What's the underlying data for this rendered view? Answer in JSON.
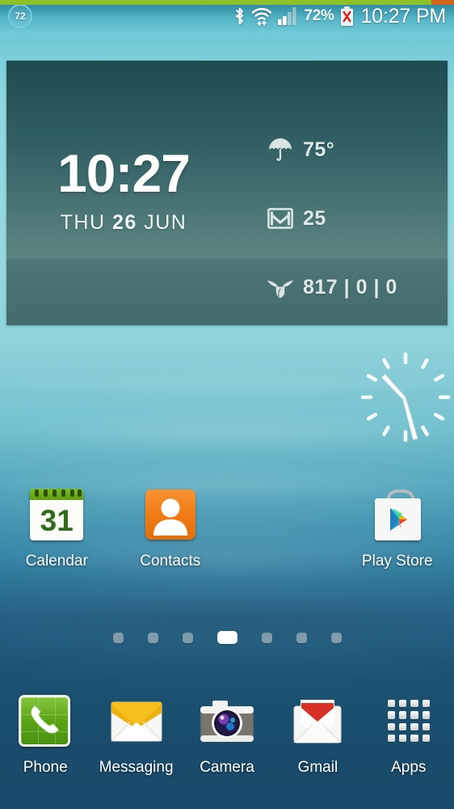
{
  "accent_bar": {
    "fill_percent": 95,
    "fill_color": "#8cc227",
    "track_color": "#d2661d"
  },
  "status_bar": {
    "left_badge": "72",
    "battery_percent": "72%",
    "clock": "10:27 PM",
    "icons": [
      "bluetooth-icon",
      "wifi-icon",
      "signal-icon",
      "battery-error-icon"
    ]
  },
  "widget": {
    "time": "10:27",
    "date_day": "THU",
    "date_num": "26",
    "date_month": "JUN",
    "info": [
      {
        "icon": "umbrella-icon",
        "value": "75°"
      },
      {
        "icon": "gmail-icon",
        "value": "25"
      },
      {
        "icon": "bird-icon",
        "value": "817 | 0 | 0"
      }
    ]
  },
  "analog_clock": {
    "hour": 10,
    "minute": 27,
    "ticks": 12
  },
  "apps": [
    {
      "label": "Calendar",
      "icon": "calendar-icon",
      "day": "31"
    },
    {
      "label": "Contacts",
      "icon": "contacts-icon"
    },
    {
      "label": "",
      "icon": ""
    },
    {
      "label": "Play Store",
      "icon": "play-store-icon"
    }
  ],
  "page_indicator": {
    "count": 7,
    "active_index": 3
  },
  "dock": [
    {
      "label": "Phone",
      "icon": "phone-icon"
    },
    {
      "label": "Messaging",
      "icon": "messaging-icon"
    },
    {
      "label": "Camera",
      "icon": "camera-icon"
    },
    {
      "label": "Gmail",
      "icon": "gmail-icon"
    },
    {
      "label": "Apps",
      "icon": "apps-grid-icon"
    }
  ],
  "colors": {
    "wallpaper_top": "#8ed6de",
    "wallpaper_bottom": "#1a4a69",
    "widget_bg": "#4d7476",
    "accent_green": "#8cc227",
    "contacts_orange": "#ef7a13",
    "phone_green": "#5aa414",
    "gmail_red": "#d93025"
  }
}
